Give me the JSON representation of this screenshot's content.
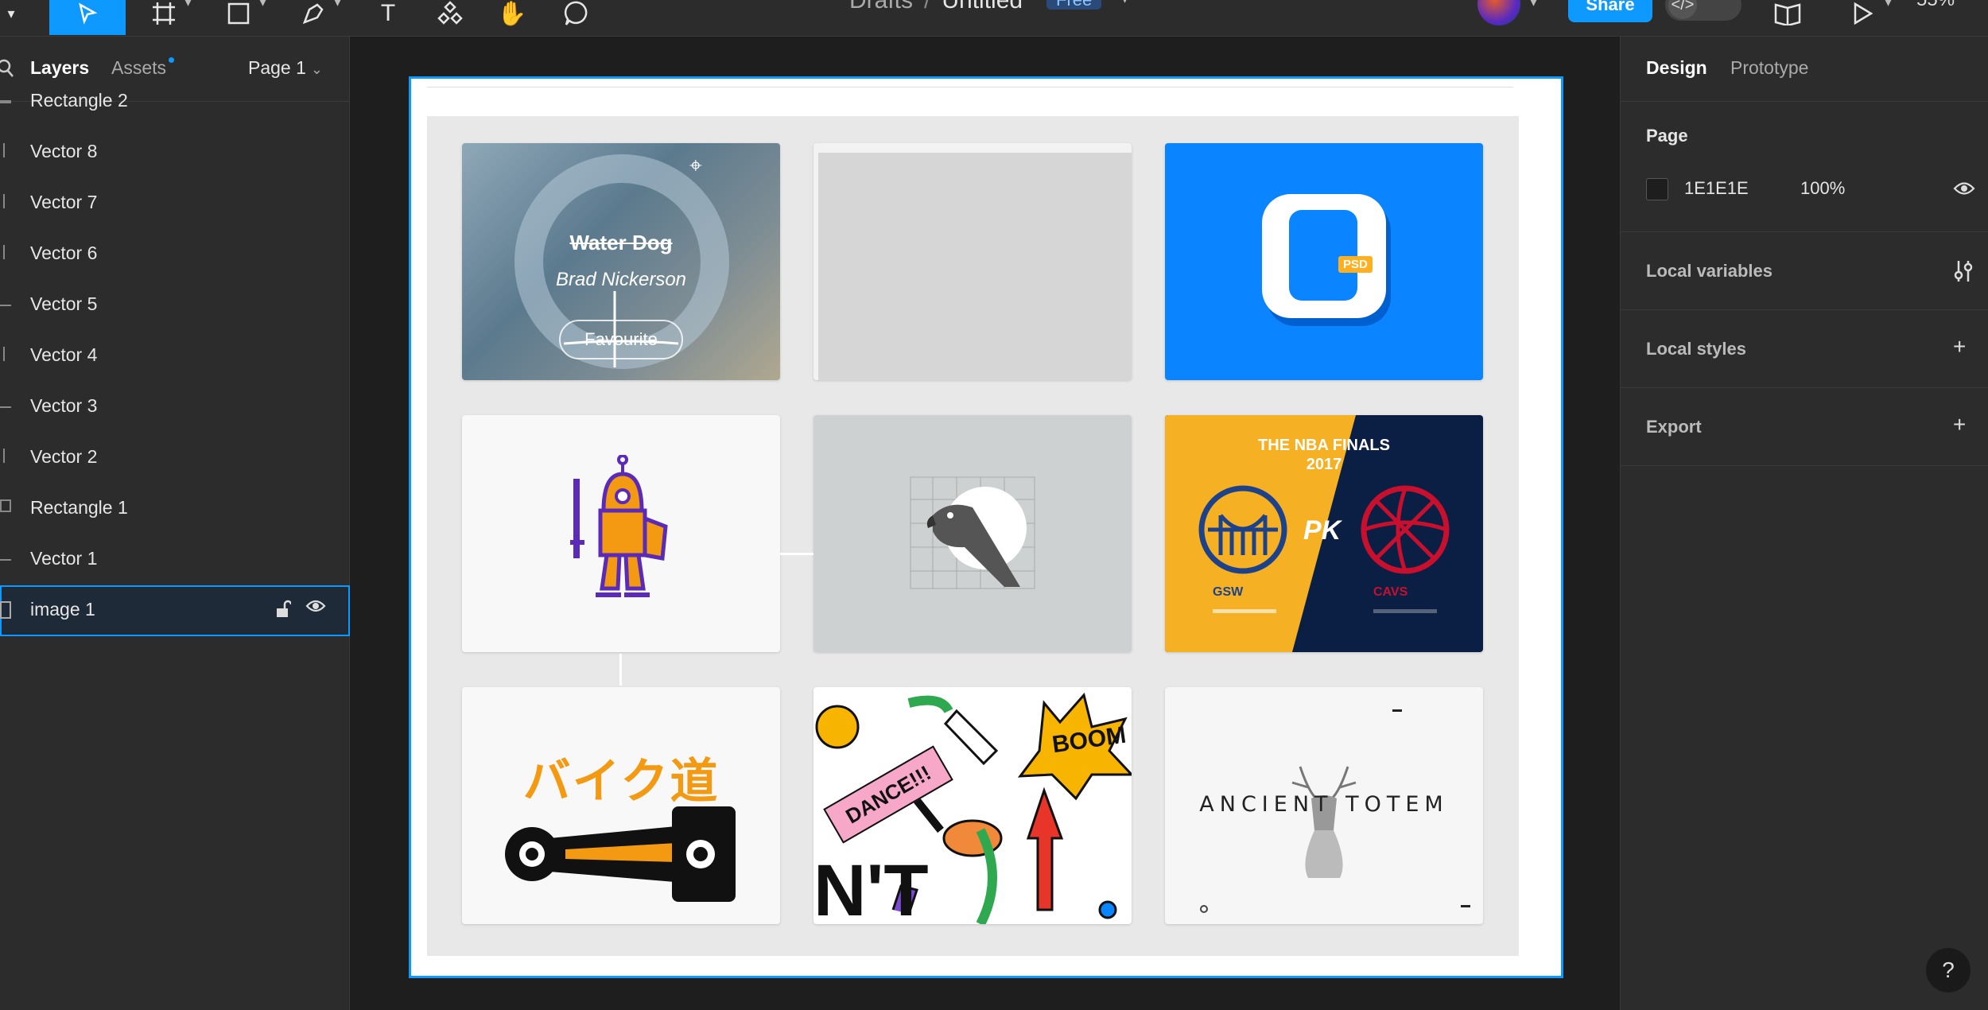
{
  "topbar": {
    "breadcrumb_parent": "Drafts",
    "breadcrumb_sep": "/",
    "file_name": "Untitled",
    "plan_badge": "Free",
    "share_label": "Share",
    "dev_mode_icon": "</>",
    "zoom": "55%"
  },
  "left_panel": {
    "tab_layers": "Layers",
    "tab_assets": "Assets",
    "page_selector": "Page 1",
    "layers": [
      {
        "name": "Rectangle 2"
      },
      {
        "name": "Vector 8"
      },
      {
        "name": "Vector 7"
      },
      {
        "name": "Vector 6"
      },
      {
        "name": "Vector 5"
      },
      {
        "name": "Vector 4"
      },
      {
        "name": "Vector 3"
      },
      {
        "name": "Vector 2"
      },
      {
        "name": "Rectangle 1"
      },
      {
        "name": "Vector 1"
      },
      {
        "name": "image 1",
        "selected": true
      }
    ]
  },
  "canvas": {
    "cards": {
      "water_dog_title": "Water Dog",
      "water_dog_author": "Brad Nickerson",
      "water_dog_button": "Favourite",
      "psd_badge": "PSD",
      "nba_title_line1": "THE NBA FINALS",
      "nba_title_line2": "2017",
      "nba_team_left": "GSW",
      "nba_team_right": "CAVS",
      "nba_logo": "PK",
      "bike_title": "バイク道",
      "doodle_boom": "BOOM",
      "doodle_dance": "DANCE!!!",
      "doodle_big": "N'T",
      "totem_title": "ANCIENT TOTEM"
    }
  },
  "right_panel": {
    "tab_design": "Design",
    "tab_prototype": "Prototype",
    "page_section_title": "Page",
    "page_color_hex": "1E1E1E",
    "page_color_opacity": "100%",
    "local_variables": "Local variables",
    "local_styles": "Local styles",
    "export": "Export"
  },
  "help_label": "?",
  "colors": {
    "accent": "#0d99ff",
    "panel_bg": "#2c2c2c",
    "canvas_bg": "#1e1e1e"
  }
}
